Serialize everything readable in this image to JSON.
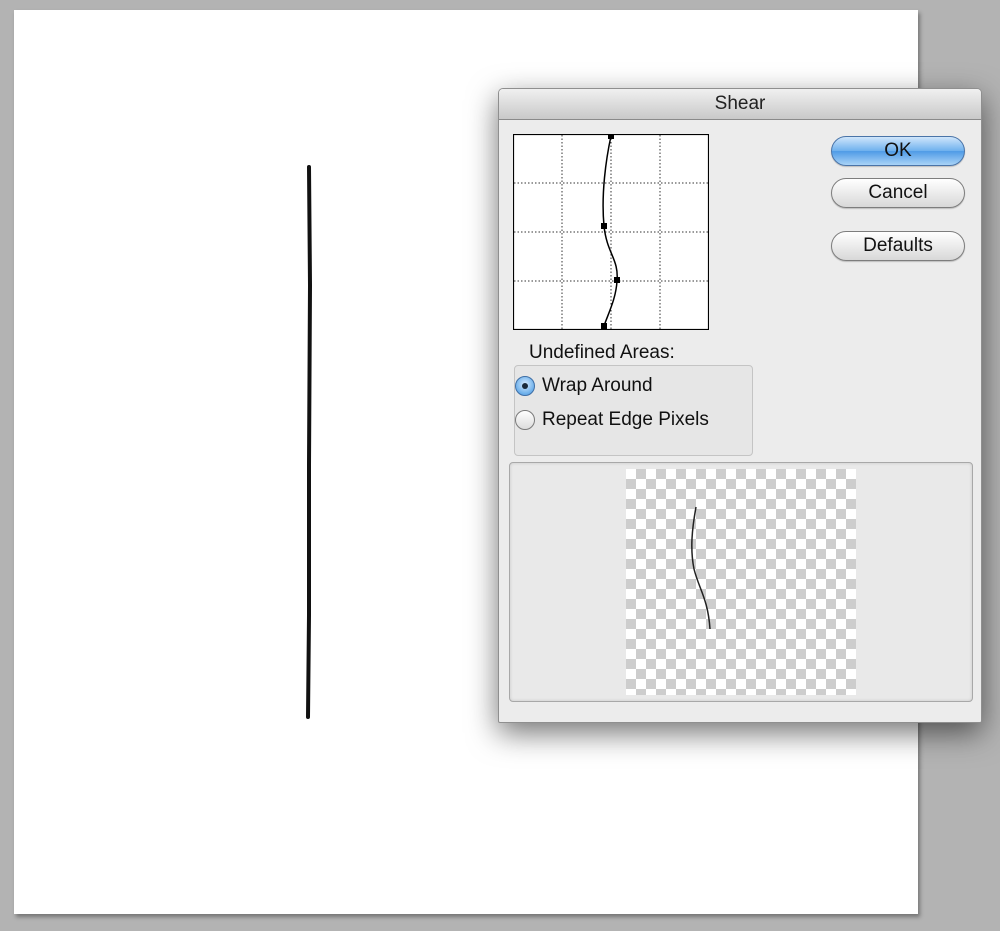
{
  "dialog": {
    "title": "Shear",
    "buttons": {
      "ok": "OK",
      "cancel": "Cancel",
      "defaults": "Defaults"
    },
    "undefined_areas": {
      "label": "Undefined Areas:",
      "options": [
        {
          "label": "Wrap Around",
          "selected": true
        },
        {
          "label": "Repeat Edge Pixels",
          "selected": false
        }
      ]
    }
  },
  "colors": {
    "primary_button": "#6db0ee",
    "dialog_background": "#ececec",
    "workspace_background": "#b3b3b3"
  }
}
